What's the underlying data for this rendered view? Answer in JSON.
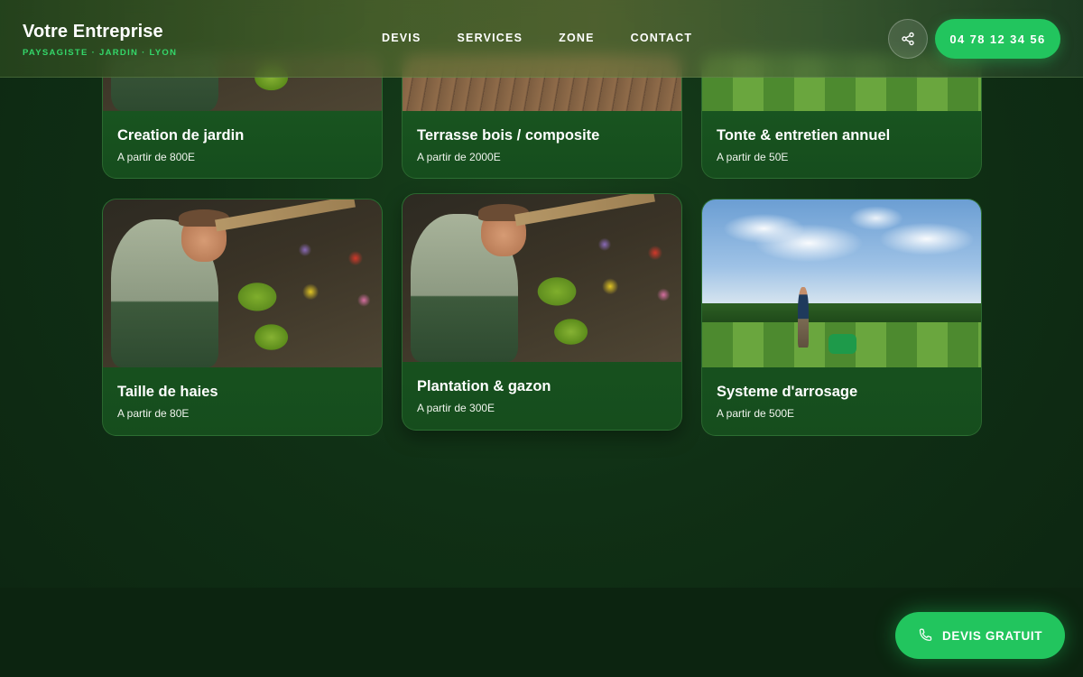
{
  "header": {
    "brand_name": "Votre Entreprise",
    "brand_tagline": "PAYSAGISTE · JARDIN · LYON",
    "nav": [
      {
        "label": "DEVIS"
      },
      {
        "label": "SERVICES"
      },
      {
        "label": "ZONE"
      },
      {
        "label": "CONTACT"
      }
    ],
    "share_icon": "share-icon",
    "phone_label": "04 78 12 34 56"
  },
  "services": [
    {
      "title": "Creation de jardin",
      "price": "A partir de 800E"
    },
    {
      "title": "Terrasse bois / composite",
      "price": "A partir de 2000E"
    },
    {
      "title": "Tonte & entretien annuel",
      "price": "A partir de 50E"
    },
    {
      "title": "Taille de haies",
      "price": "A partir de 80E"
    },
    {
      "title": "Plantation & gazon",
      "price": "A partir de 300E"
    },
    {
      "title": "Systeme d'arrosage",
      "price": "A partir de 500E"
    }
  ],
  "cta": {
    "label": "DEVIS GRATUIT",
    "icon": "phone-icon"
  },
  "colors": {
    "accent": "#22c55e",
    "background": "#103015",
    "card": "#1a5a22"
  }
}
